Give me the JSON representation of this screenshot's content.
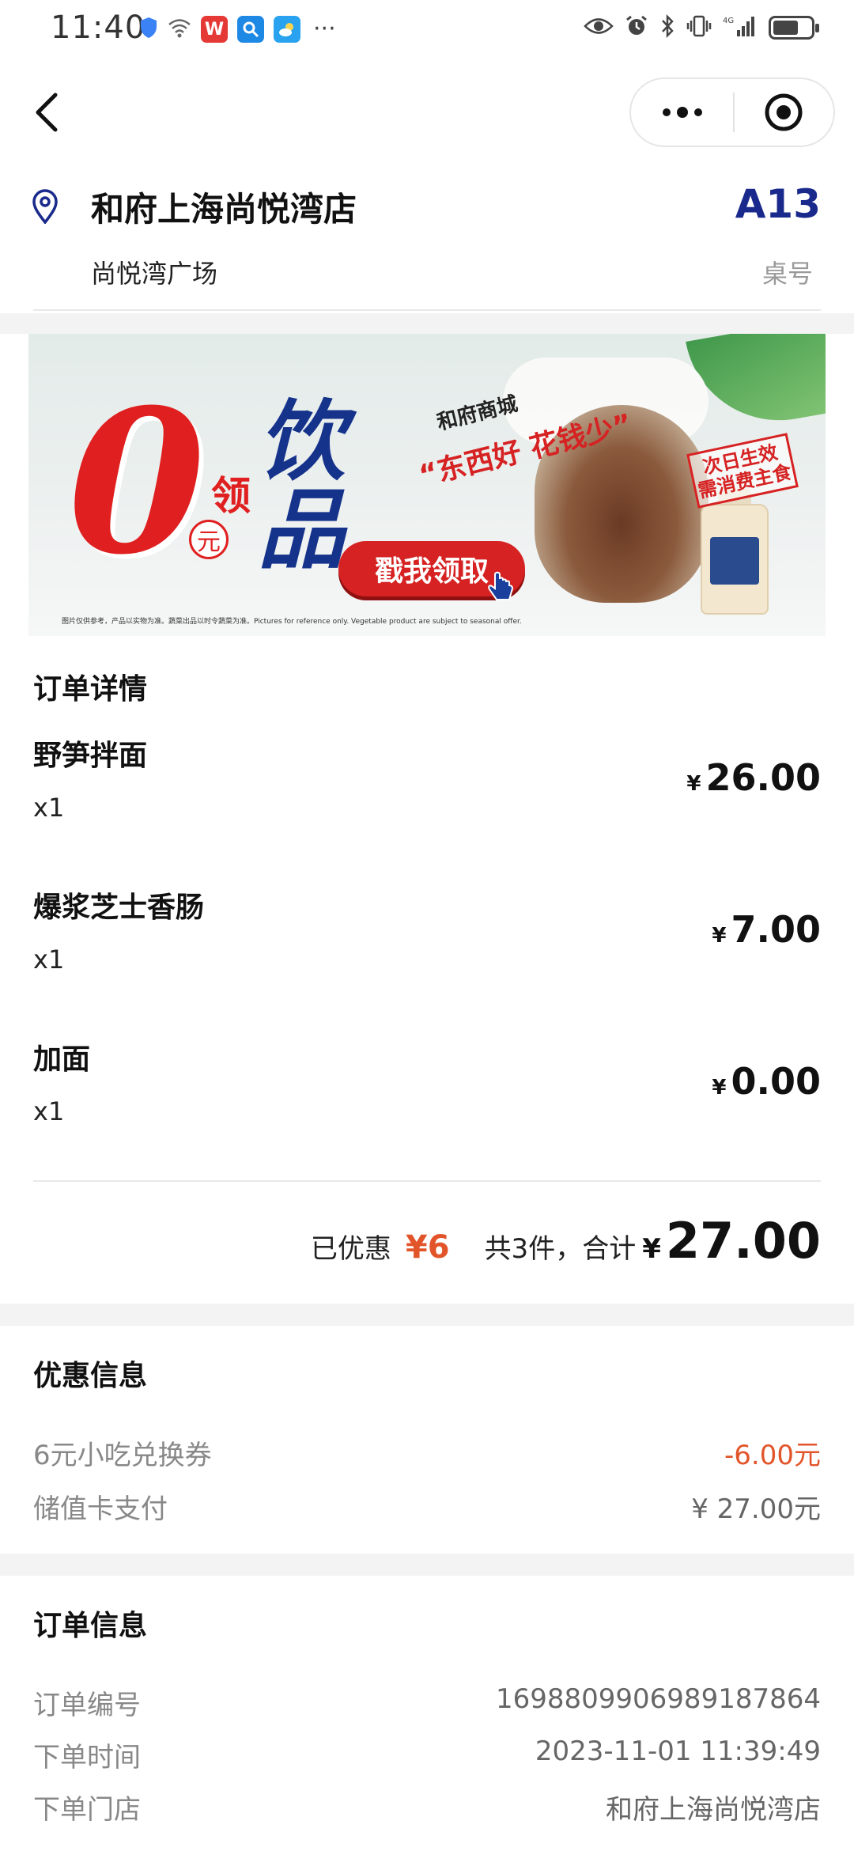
{
  "status_bar": {
    "time": "11:40",
    "more": "···",
    "network": "4G"
  },
  "store": {
    "name": "和府上海尚悦湾店",
    "subtitle": "尚悦湾广场",
    "table_number": "A13",
    "table_label": "桌号"
  },
  "banner": {
    "zero": "0",
    "ling": "领",
    "yuan": "元",
    "drink": "饮品",
    "button": "戳我领取",
    "mall": "和府商城",
    "slogan": "“东西好 花钱少”",
    "stamp": "次日生效 需消费主食",
    "fine_print": "图片仅供参考，产品以实物为准。蔬菜出品以时令蔬菜为准。Pictures for reference only. Vegetable product are subject to seasonal offer."
  },
  "order_details": {
    "title": "订单详情",
    "items": [
      {
        "name": "野笋拌面",
        "qty": "x1",
        "currency": "¥",
        "price": "26.00"
      },
      {
        "name": "爆浆芝士香肠",
        "qty": "x1",
        "currency": "¥",
        "price": "7.00"
      },
      {
        "name": "加面",
        "qty": "x1",
        "currency": "¥",
        "price": "0.00"
      }
    ],
    "summary": {
      "discount_label": "已优惠",
      "discount_value": "¥6",
      "count_text": "共3件，合计",
      "currency": "¥",
      "total": "27.00"
    }
  },
  "discount_info": {
    "title": "优惠信息",
    "rows": [
      {
        "label": "6元小吃兑换券",
        "value": "-6.00元"
      },
      {
        "label": "储值卡支付",
        "value": "¥ 27.00元"
      }
    ]
  },
  "order_info": {
    "title": "订单信息",
    "rows": [
      {
        "label": "订单编号",
        "value": "1698809906989187864"
      },
      {
        "label": "下单时间",
        "value": "2023-11-01 11:39:49"
      },
      {
        "label": "下单门店",
        "value": "和府上海尚悦湾店"
      }
    ]
  },
  "colors": {
    "accent_red": "#e2552b",
    "table_blue": "#1a2a8c",
    "section_gap": "#f3f3f3"
  }
}
